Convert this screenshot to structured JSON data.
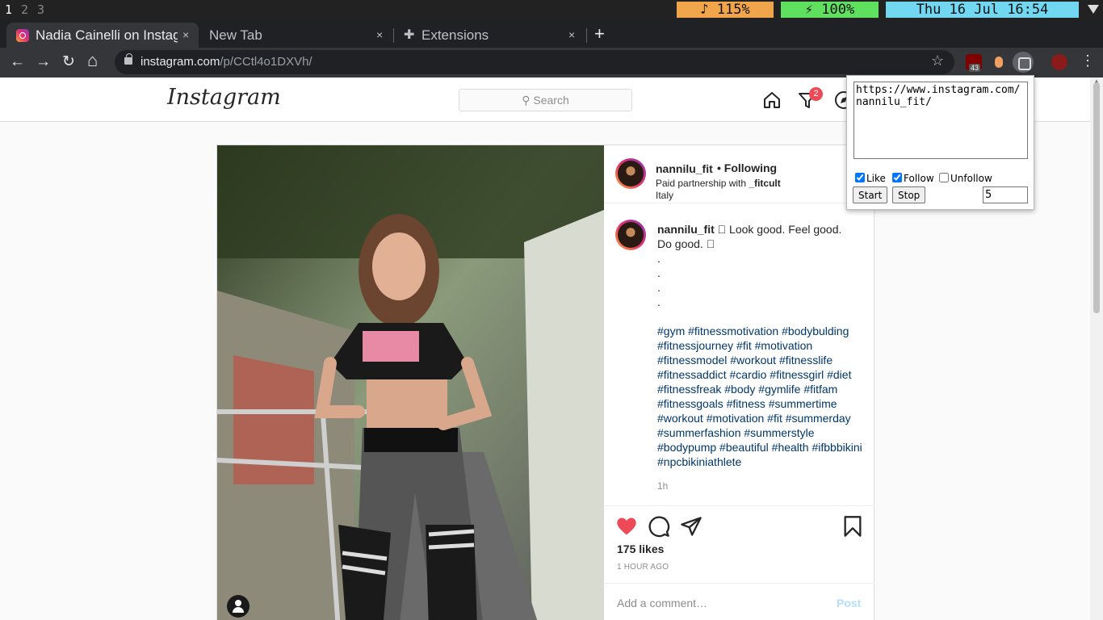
{
  "statusbar": {
    "workspaces": [
      {
        "label": "1",
        "active": true
      },
      {
        "label": "2",
        "active": false
      },
      {
        "label": "3",
        "active": false
      }
    ],
    "volume": "♪ 115%",
    "battery": "⚡ 100%",
    "clock": "Thu 16 Jul 16:54",
    "colors": {
      "volume": "#f0a54a",
      "battery": "#5fe05f",
      "clock": "#72d7f0"
    }
  },
  "tabs": [
    {
      "label": "Nadia Cainelli on Instagram",
      "close": "×",
      "icon": "instagram-icon",
      "active": true
    },
    {
      "label": "New Tab",
      "close": "×",
      "active": false
    },
    {
      "label": "Extensions",
      "close": "×",
      "icon": "puzzle-icon",
      "active": false
    }
  ],
  "new_tab_label": "+",
  "toolbar": {
    "back": "←",
    "forward": "→",
    "reload": "↻",
    "home": "⌂",
    "url_host": "instagram.com",
    "url_path": "/p/CCtl4o1DXVh/",
    "star": "☆",
    "ext_badge": "43",
    "menu": "⋮"
  },
  "instagram": {
    "logo": "Instagram",
    "search_placeholder": "Search",
    "notification_count": "2",
    "post": {
      "username": "nannilu_fit",
      "follow_state": "• Following",
      "partnership_prefix": "Paid partnership with ",
      "partner": "_fitcult",
      "location": "Italy",
      "caption_line1": "🏻 Look good. Feel good.",
      "caption_line2": "Do good. 🏻",
      "dots": [
        ".",
        ".",
        ".",
        "."
      ],
      "hashtags": "#gym #fitnessmotivation #bodybulding #fitnessjourney #fit #motivation #fitnessmodel #workout #fitnesslife #fitnessaddict #cardio #fitnessgirl #diet #fitnessfreak #body #gymlife #fitfam #fitnessgoals #fitness #summertime #workout #motivation #fit #summerday #summerfashion #summerstyle #bodypump #beautiful #health #ifbbbikini #npcbikiniathlete",
      "time_short": "1h",
      "likes": "175 likes",
      "time_long": "1 HOUR AGO",
      "comment_placeholder": "Add a comment…",
      "post_button": "Post",
      "liked": true
    }
  },
  "popup": {
    "url_value": "https://www.instagram.com/nannilu_fit/",
    "like_label": "Like",
    "like_checked": true,
    "follow_label": "Follow",
    "follow_checked": true,
    "unfollow_label": "Unfollow",
    "unfollow_checked": false,
    "start_label": "Start",
    "stop_label": "Stop",
    "count_value": "5"
  }
}
